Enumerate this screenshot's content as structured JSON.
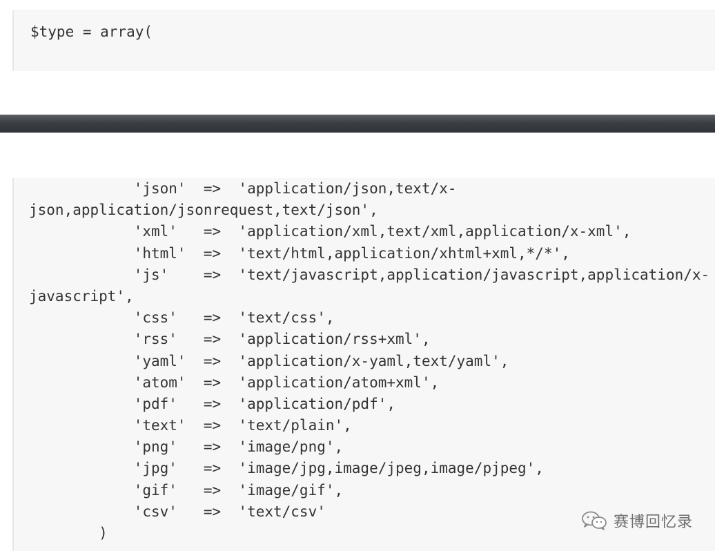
{
  "top_code": {
    "line": "$type = array("
  },
  "main_code": {
    "lines": [
      "            'json'  =>  'application/json,text/x-",
      "json,application/jsonrequest,text/json',",
      "            'xml'   =>  'application/xml,text/xml,application/x-xml',",
      "            'html'  =>  'text/html,application/xhtml+xml,*/*',",
      "            'js'    =>  'text/javascript,application/javascript,application/x-",
      "javascript',",
      "            'css'   =>  'text/css',",
      "            'rss'   =>  'application/rss+xml',",
      "            'yaml'  =>  'application/x-yaml,text/yaml',",
      "            'atom'  =>  'application/atom+xml',",
      "            'pdf'   =>  'application/pdf',",
      "            'text'  =>  'text/plain',",
      "            'png'   =>  'image/png',",
      "            'jpg'   =>  'image/jpg,image/jpeg,image/pjpeg',",
      "            'gif'   =>  'image/gif',",
      "            'csv'   =>  'text/csv'",
      "        )"
    ]
  },
  "watermark": {
    "icon": "wechat-icon",
    "text": "赛博回忆录"
  },
  "colors": {
    "code_background": "#f7f7f7",
    "code_text": "#333333",
    "separator": "#3c4044"
  }
}
